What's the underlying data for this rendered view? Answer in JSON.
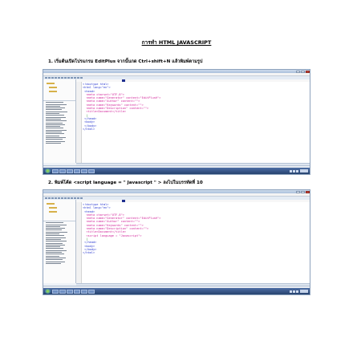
{
  "document": {
    "title": "การทำ HTML JAVASCRIPT",
    "steps": [
      {
        "label": "1. เริ่มต้นเปิดโปรแกรม EditPlus จากนั้นกด Ctrl+shift+N แล้วพิมพ์ตามรูป",
        "code": [
          {
            "text": "<!doctype html>",
            "kind": "tag"
          },
          {
            "text": "<html lang=\"en\">",
            "kind": "tag"
          },
          {
            "text": " <head>",
            "kind": "tag"
          },
          {
            "text": "  <meta charset=\"UTF-8\">",
            "kind": "attr"
          },
          {
            "text": "  <meta name=\"Generator\" content=\"EditPlus®\">",
            "kind": "attr"
          },
          {
            "text": "  <meta name=\"Author\" content=\"\">",
            "kind": "attr"
          },
          {
            "text": "  <meta name=\"Keywords\" content=\"\">",
            "kind": "attr"
          },
          {
            "text": "  <meta name=\"Description\" content=\"\">",
            "kind": "attr"
          },
          {
            "text": "  <title>Document</title>",
            "kind": "attr"
          },
          {
            "text": "  |",
            "kind": "cur"
          },
          {
            "text": " </head>",
            "kind": "tag"
          },
          {
            "text": " <body>",
            "kind": "tag"
          },
          {
            "text": "",
            "kind": "tag"
          },
          {
            "text": " </body>",
            "kind": "tag"
          },
          {
            "text": "</html>",
            "kind": "tag"
          }
        ]
      },
      {
        "label": "2. พิมพ์โค้ด <script language = \" Javascript \" > ลงไปในบรรทัดที่ 10",
        "code": [
          {
            "text": "<!doctype html>",
            "kind": "tag"
          },
          {
            "text": "<html lang=\"en\">",
            "kind": "tag"
          },
          {
            "text": " <head>",
            "kind": "tag"
          },
          {
            "text": "  <meta charset=\"UTF-8\">",
            "kind": "attr"
          },
          {
            "text": "  <meta name=\"Generator\" content=\"EditPlus®\">",
            "kind": "attr"
          },
          {
            "text": "  <meta name=\"Author\" content=\"\">",
            "kind": "attr"
          },
          {
            "text": "  <meta name=\"Keywords\" content=\"\">",
            "kind": "attr"
          },
          {
            "text": "  <meta name=\"Description\" content=\"\">",
            "kind": "attr"
          },
          {
            "text": "  <title>Document</title>",
            "kind": "attr"
          },
          {
            "text": "  <script language = \"Javascript\">",
            "kind": "attr"
          },
          {
            "text": "  |",
            "kind": "cur"
          },
          {
            "text": " </head>",
            "kind": "tag"
          },
          {
            "text": " <body>",
            "kind": "tag"
          },
          {
            "text": "",
            "kind": "tag"
          },
          {
            "text": " </body>",
            "kind": "tag"
          },
          {
            "text": "</html>",
            "kind": "tag"
          }
        ]
      }
    ]
  }
}
